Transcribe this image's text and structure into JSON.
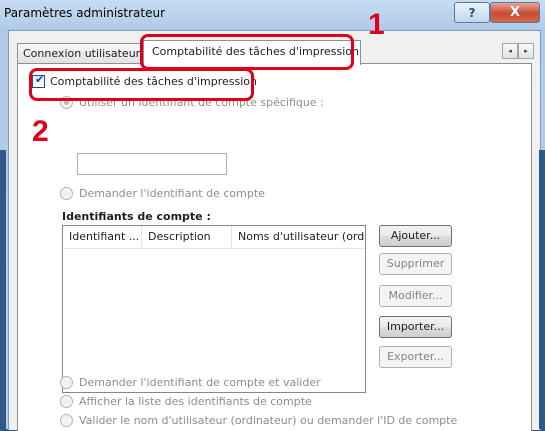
{
  "window": {
    "title": "Paramètres administrateur",
    "help_symbol": "?",
    "close_symbol": "X"
  },
  "tabs": [
    {
      "label": "Connexion utilisateur"
    },
    {
      "label": "Comptabilité des tâches d'impression"
    }
  ],
  "tab_scroll": {
    "left": "◂",
    "right": "▸"
  },
  "job_accounting_checkbox": {
    "label": "Comptabilité des tâches d'impression",
    "checked": true
  },
  "options": {
    "specific_id_label": "Utiliser un identifiant de compte spécifique :",
    "specific_id_value": "",
    "prompt_id_label": "Demander l'identifiant de compte",
    "ids_list_label": "Identifiants de compte :",
    "prompt_validate_label": "Demander l'identifiant de compte et valider",
    "display_list_label": "Afficher la liste des identifiants de compte",
    "validate_user_label": "Valider le nom d'utilisateur (ordinateur) ou demander l'ID de compte"
  },
  "list_columns": [
    "Identifiant ...",
    "Description",
    "Noms d'utilisateur (ordi"
  ],
  "buttons": {
    "add": "Ajouter...",
    "delete": "Supprimer",
    "modify": "Modifier...",
    "import": "Importer...",
    "export": "Exporter..."
  },
  "callouts": {
    "step1": "1",
    "step2": "2"
  },
  "colors": {
    "callout_red": "#e0001b",
    "title_gradient": "#c6dcf3"
  }
}
